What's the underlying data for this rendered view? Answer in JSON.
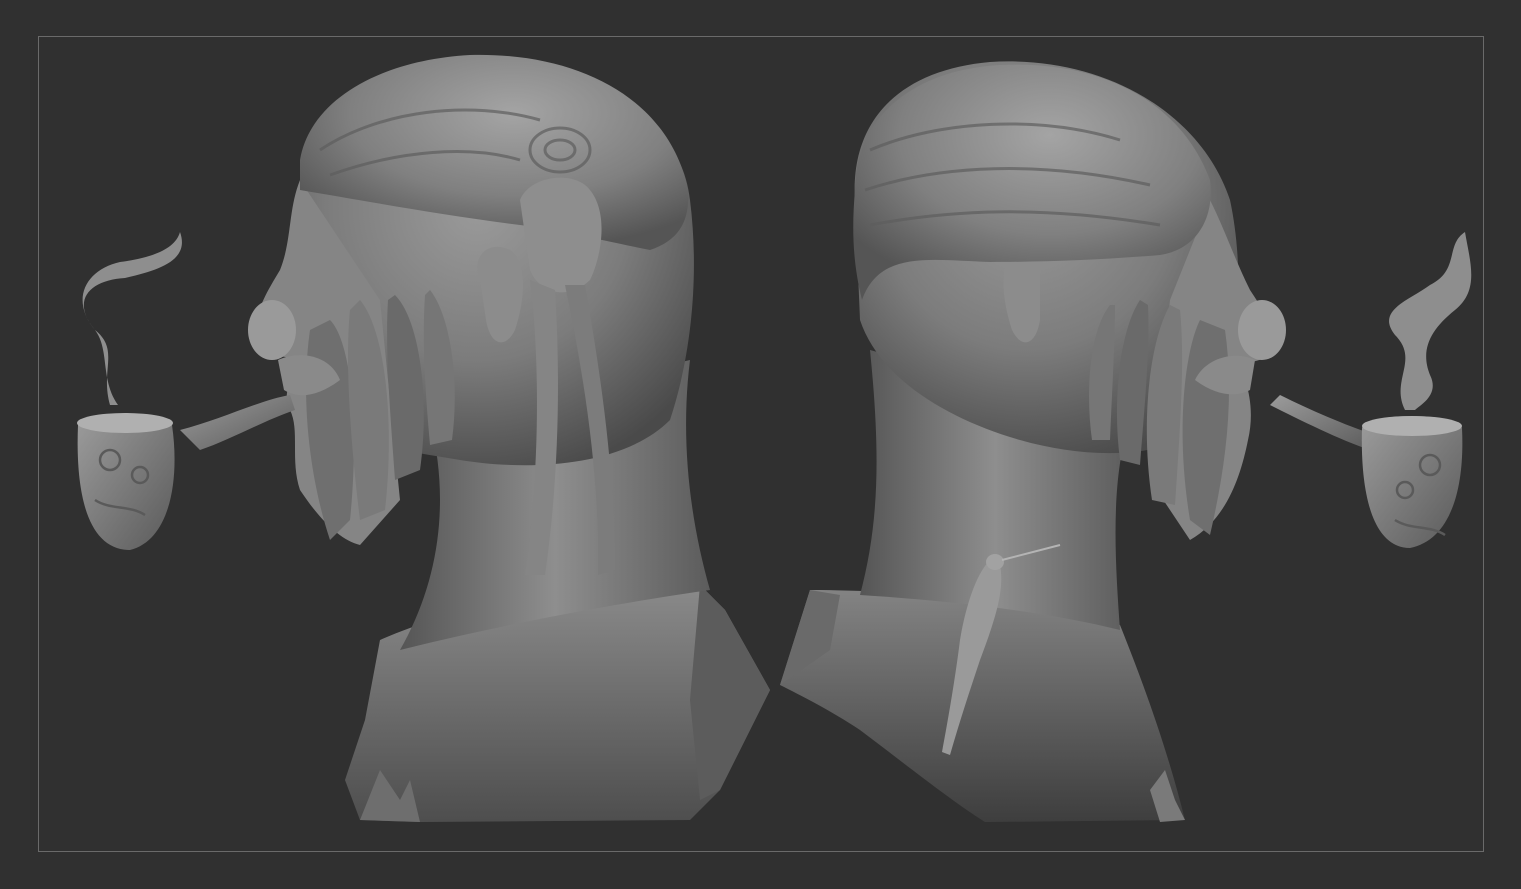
{
  "viewport": {
    "background_color": "#303030",
    "frame_border_color": "#6a6a6a"
  },
  "scene": {
    "models": [
      {
        "name": "head-left-view",
        "subject": "bust-with-headwrap-and-pipe"
      },
      {
        "name": "head-right-view",
        "subject": "bust-with-headwrap-pipe-and-bird"
      }
    ],
    "material_color": "#7a7a7a"
  }
}
